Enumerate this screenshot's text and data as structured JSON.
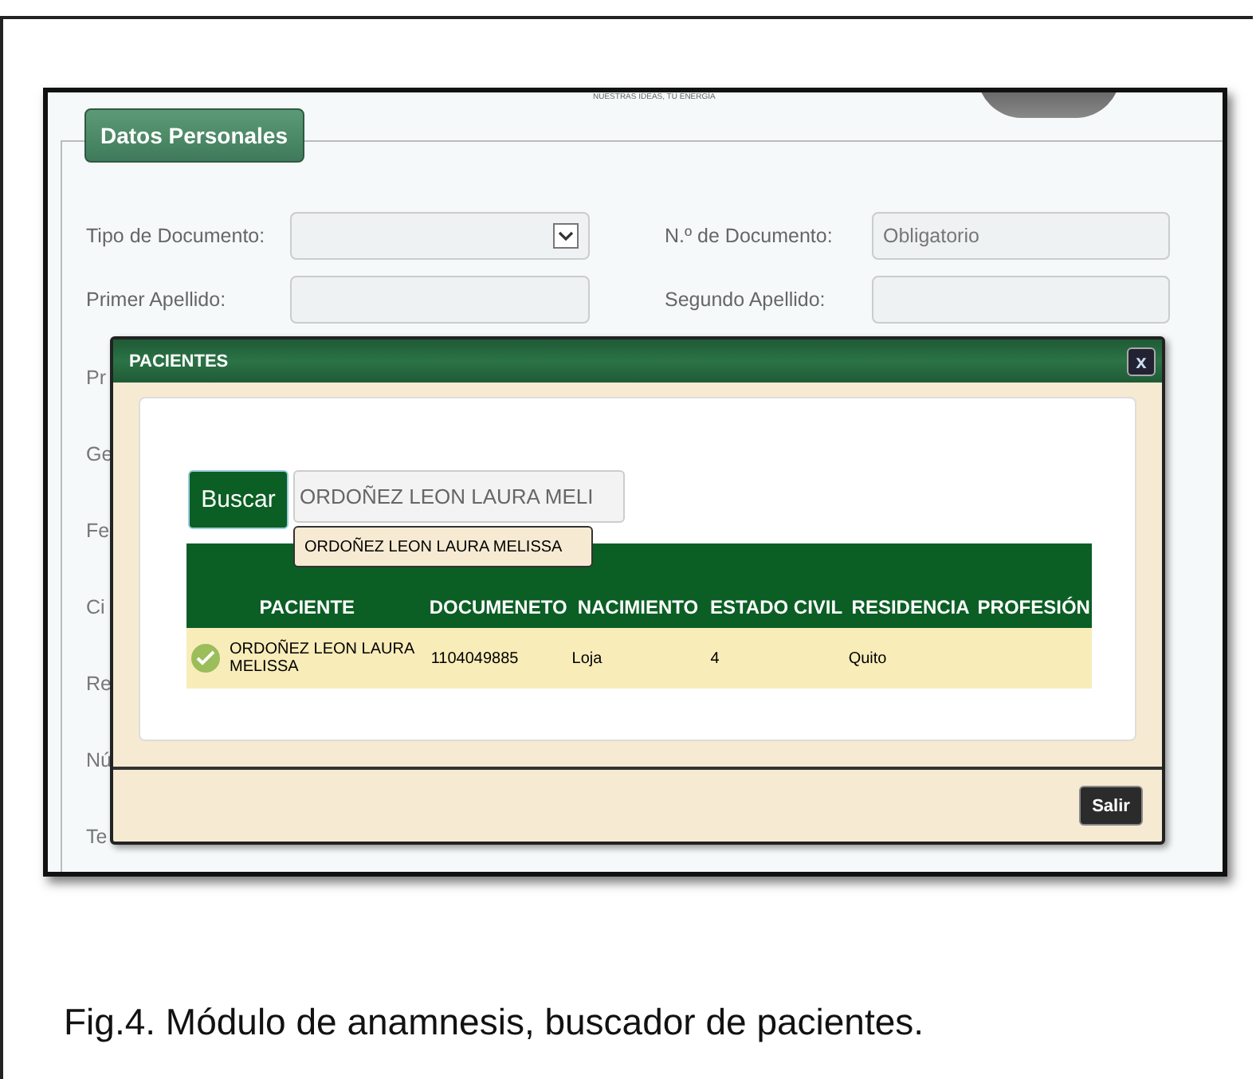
{
  "header": {
    "tagline": "NUESTRAS IDEAS, TU ENERGÍA"
  },
  "form": {
    "legend": "Datos Personales",
    "fields": [
      {
        "label": "Tipo de Documento:",
        "kind": "select"
      },
      {
        "label": "N.º de Documento:",
        "kind": "text",
        "placeholder": "Obligatorio"
      },
      {
        "label": "Primer Apellido:",
        "kind": "text"
      },
      {
        "label": "Segundo Apellido:",
        "kind": "text"
      }
    ],
    "hidden_labels": [
      "Pr",
      "Ge",
      "Fe",
      "Ci",
      "Re",
      "Nú",
      "Te"
    ]
  },
  "dialog": {
    "title": "PACIENTES",
    "close": "x",
    "search_button": "Buscar",
    "search_value": "ORDOÑEZ LEON LAURA MELI",
    "suggestions": [
      "ORDOÑEZ LEON LAURA MELISSA"
    ],
    "table": {
      "columns": [
        "PACIENTE",
        "DOCUMENETO",
        "NACIMIENTO",
        "ESTADO CIVIL",
        "RESIDENCIA",
        "PROFESIÓN"
      ],
      "rows": [
        {
          "cells": [
            "ORDOÑEZ LEON LAURA MELISSA",
            "1104049885",
            "Loja",
            "4",
            "Quito",
            ""
          ]
        }
      ]
    },
    "exit_button": "Salir"
  },
  "caption": "Fig.4. Módulo de anamnesis, buscador de pacientes."
}
